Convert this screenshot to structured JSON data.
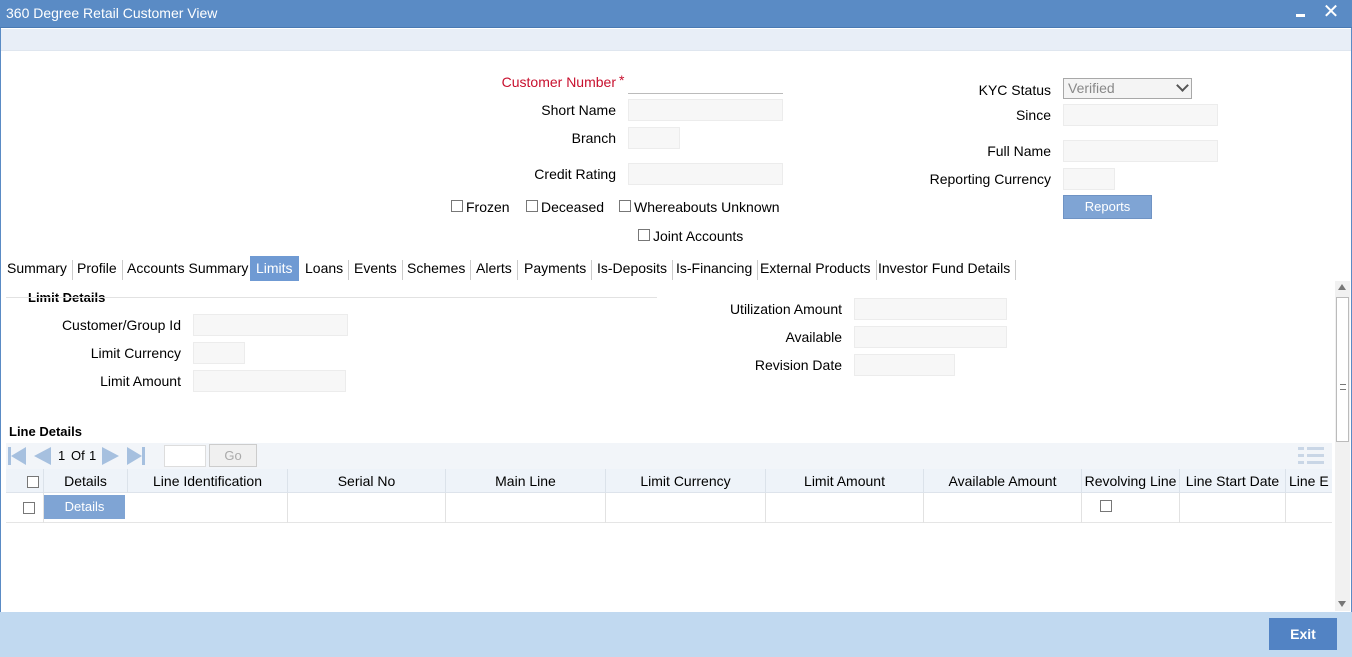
{
  "window": {
    "title": "360 Degree Retail Customer View"
  },
  "header_fields": {
    "customer_number_label": "Customer Number",
    "required_mark": "*",
    "short_name_label": "Short Name",
    "branch_label": "Branch",
    "credit_rating_label": "Credit Rating",
    "kyc_status_label": "KYC Status",
    "kyc_status_value": "Verified",
    "since_label": "Since",
    "full_name_label": "Full Name",
    "reporting_currency_label": "Reporting Currency",
    "reports_button": "Reports"
  },
  "flags": {
    "frozen": "Frozen",
    "deceased": "Deceased",
    "whereabouts_unknown": "Whereabouts Unknown",
    "joint_accounts": "Joint Accounts"
  },
  "tabs": [
    "Summary",
    "Profile",
    "Accounts Summary",
    "Limits",
    "Loans",
    "Events",
    "Schemes",
    "Alerts",
    "Payments",
    "Is-Deposits",
    "Is-Financing",
    "External Products",
    "Investor Fund Details"
  ],
  "active_tab": "Limits",
  "limit_details": {
    "section_title": "Limit Details",
    "customer_group_id_label": "Customer/Group Id",
    "limit_currency_label": "Limit Currency",
    "limit_amount_label": "Limit Amount",
    "utilization_amount_label": "Utilization Amount",
    "available_label": "Available",
    "revision_date_label": "Revision Date"
  },
  "line_details": {
    "section_title": "Line Details",
    "pager": {
      "current": "1",
      "of_label": "Of",
      "total": "1",
      "go_label": "Go"
    },
    "columns": [
      "Details",
      "Line Identification",
      "Serial No",
      "Main Line",
      "Limit Currency",
      "Limit Amount",
      "Available Amount",
      "Revolving Line",
      "Line Start Date",
      "Line E"
    ],
    "row_details_button": "Details"
  },
  "footer": {
    "exit_button": "Exit"
  }
}
